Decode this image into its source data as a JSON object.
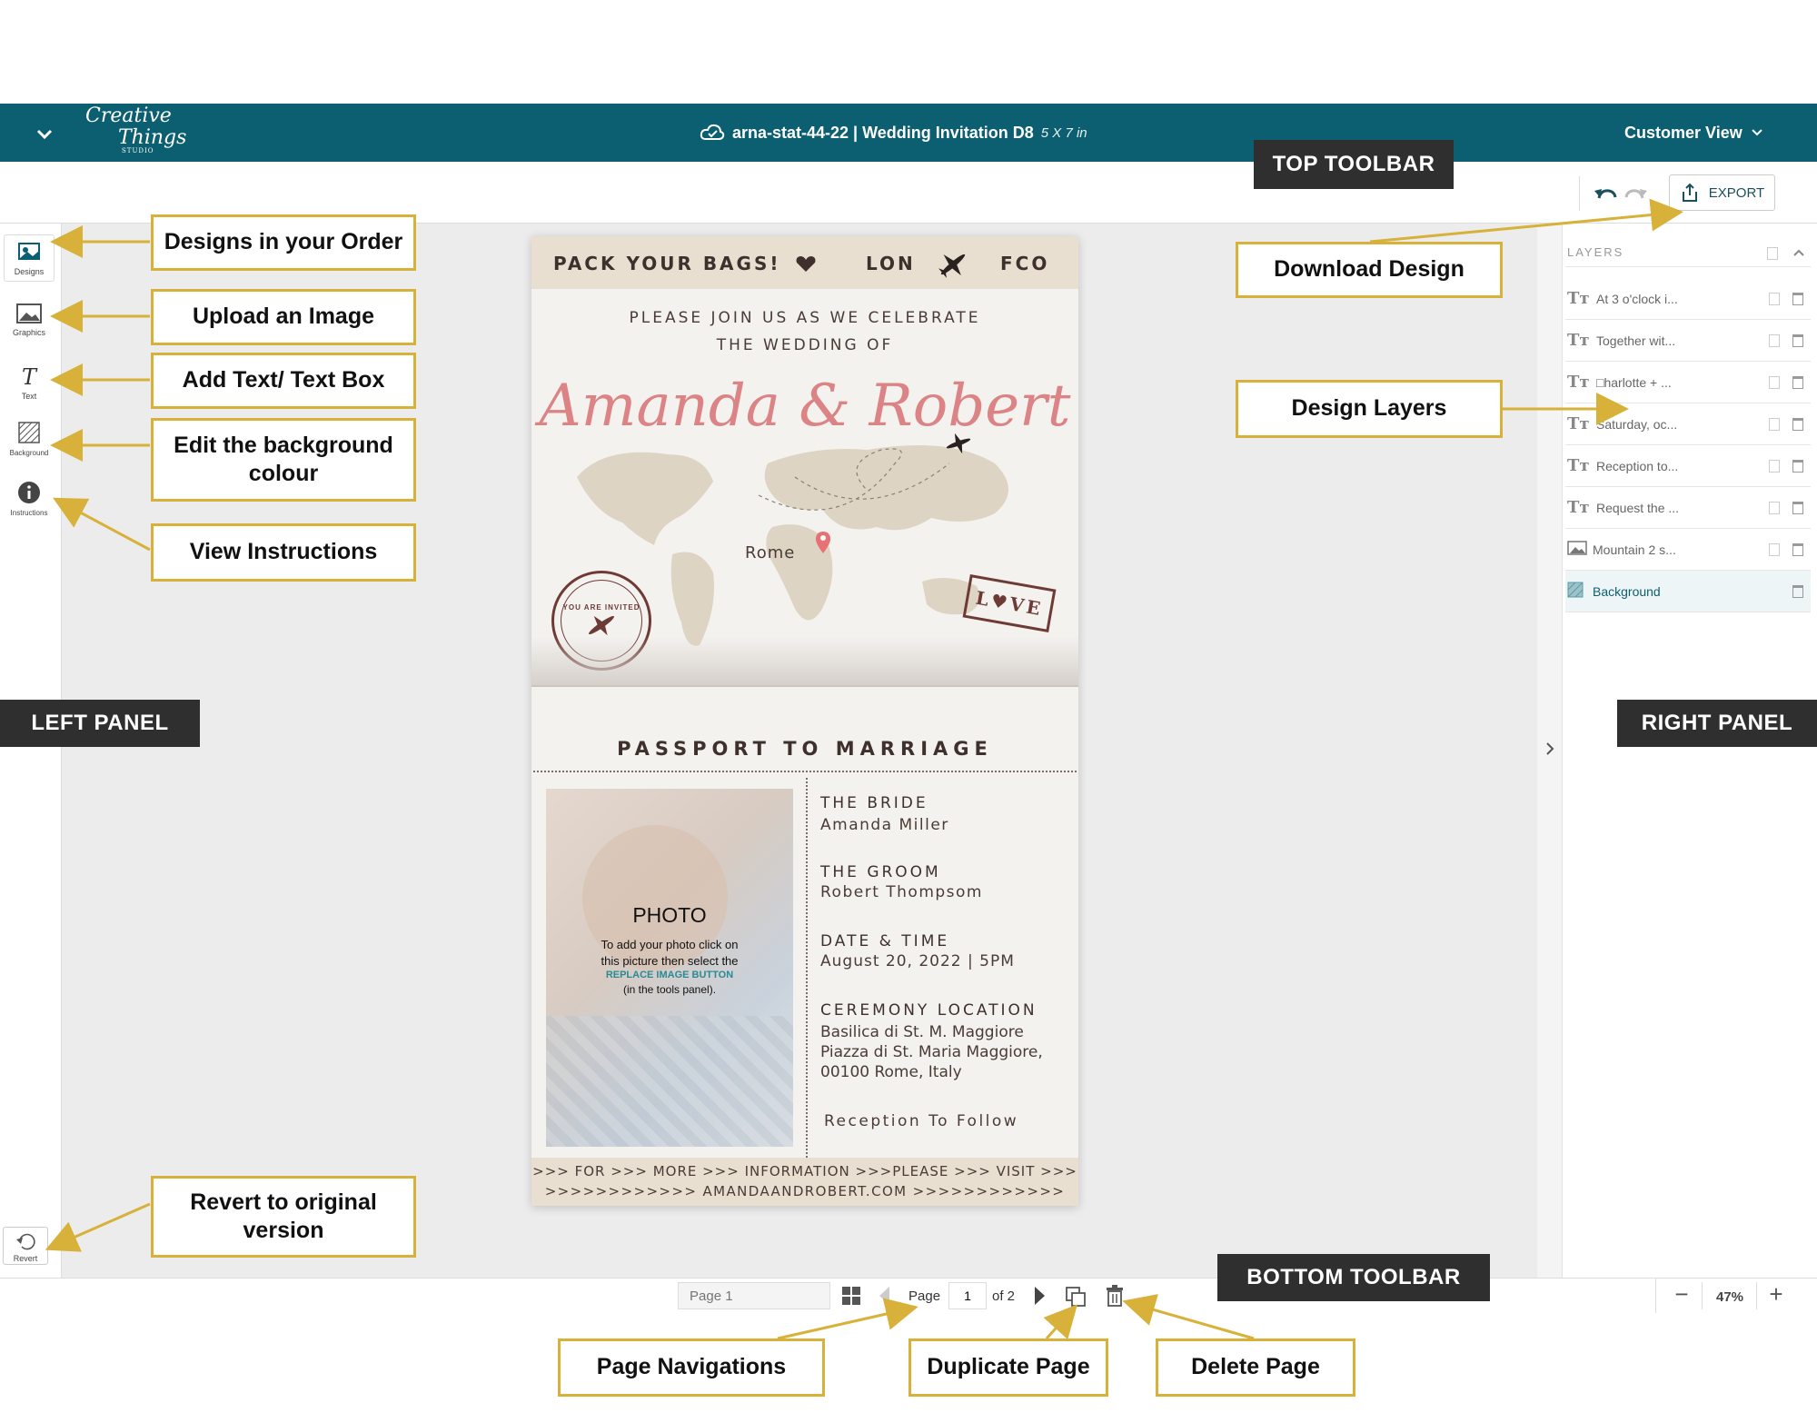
{
  "app": {
    "brand_line1": "Creative",
    "brand_line2": "Things",
    "brand_line3": "STUDIO",
    "doc_title": "arna-stat-44-22 | Wedding Invitation D8",
    "doc_size": "5 X 7 in",
    "view_mode": "Customer View",
    "export_label": "EXPORT"
  },
  "left_panel": {
    "tools": [
      {
        "label": "Designs",
        "icon": "designs-icon"
      },
      {
        "label": "Graphics",
        "icon": "image-icon"
      },
      {
        "label": "Text",
        "icon": "text-icon"
      },
      {
        "label": "Background",
        "icon": "hatch-icon"
      },
      {
        "label": "Instructions",
        "icon": "info-icon"
      }
    ],
    "revert_label": "Revert"
  },
  "right_panel": {
    "heading": "LAYERS",
    "layers": [
      {
        "name": "At 3 o'clock i...",
        "type": "text"
      },
      {
        "name": "Together wit...",
        "type": "text"
      },
      {
        "name": "□harlotte + ...",
        "type": "text"
      },
      {
        "name": "Saturday, oc...",
        "type": "text"
      },
      {
        "name": "Reception to...",
        "type": "text"
      },
      {
        "name": "Request the ...",
        "type": "text"
      },
      {
        "name": "Mountain 2 s...",
        "type": "image"
      },
      {
        "name": "Background",
        "type": "background",
        "selected": true
      }
    ]
  },
  "bottom_bar": {
    "page_name_placeholder": "Page 1",
    "page_label": "Page",
    "page_current": "1",
    "page_of": "of 2",
    "zoom": "47%"
  },
  "invitation": {
    "top_left": "PACK YOUR BAGS!",
    "top_from": "LON",
    "top_to": "FCO",
    "intro_line1": "PLEASE JOIN US AS WE CELEBRATE",
    "intro_line2": "THE WEDDING OF",
    "names": "Amanda & Robert",
    "map_city": "Rome",
    "stamp_circle": "YOU ARE INVITED",
    "stamp_love": "L♥VE",
    "section_title": "PASSPORT TO MARRIAGE",
    "photo_title": "PHOTO",
    "photo_help1": "To add your photo click on",
    "photo_help2": "this picture then select the",
    "photo_help3": "REPLACE IMAGE BUTTON",
    "photo_help4": "(in the tools panel).",
    "bride_label": "THE BRIDE",
    "bride_name": "Amanda Miller",
    "groom_label": "THE GROOM",
    "groom_name": "Robert Thompsom",
    "date_label": "DATE & TIME",
    "date_value": "August 20, 2022 | 5PM",
    "location_label": "CEREMONY LOCATION",
    "location_line1": "Basilica di St. M. Maggiore",
    "location_line2": "Piazza di St. Maria Maggiore,",
    "location_line3": "00100 Rome, Italy",
    "reception": "Reception To Follow",
    "footer_line1": ">>> FOR >>> MORE >>> INFORMATION >>>PLEASE >>> VISIT >>>",
    "footer_line2": ">>>>>>>>>>>> AMANDAANDROBERT.COM >>>>>>>>>>>>"
  },
  "callouts": {
    "designs": "Designs in your Order",
    "upload": "Upload an Image",
    "text": "Add Text/ Text Box",
    "background": "Edit the background colour",
    "instructions": "View Instructions",
    "revert": "Revert to original version",
    "download": "Download Design",
    "layers": "Design Layers",
    "page_nav": "Page Navigations",
    "duplicate": "Duplicate Page",
    "delete": "Delete Page"
  },
  "tags": {
    "top_toolbar": "TOP TOOLBAR",
    "left_panel": "LEFT PANEL",
    "right_panel": "RIGHT PANEL",
    "bottom_toolbar": "BOTTOM TOOLBAR"
  },
  "colors": {
    "topbar": "#0b5f70",
    "callout_border": "#d8b13a",
    "tag_bg": "#2f2f2f",
    "invite_band": "#e9dfd0",
    "script_names": "#d9777a"
  }
}
